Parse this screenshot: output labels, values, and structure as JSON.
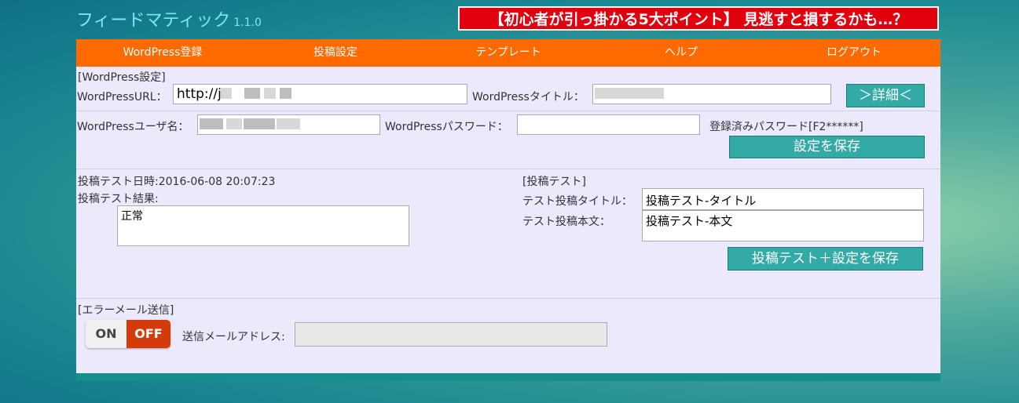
{
  "header": {
    "app_name": "フィードマティック",
    "version": "1.1.0",
    "banner": "【初心者が引っ掛かる5大ポイント】 見逃すと損するかも…？"
  },
  "nav": [
    "WordPress登録",
    "投稿設定",
    "テンプレート",
    "ヘルプ",
    "ログアウト"
  ],
  "wp_settings": {
    "section_title": "[WordPress設定]",
    "url_label": "WordPressURL：",
    "url_value": "http://j",
    "title_label": "WordPressタイトル：",
    "title_value": "",
    "detail_button": "＞詳細＜",
    "user_label": "WordPressユーザ名：",
    "user_value": "",
    "password_label": "WordPressパスワード：",
    "password_value": "",
    "registered_password": "登録済みパスワード[F2******]",
    "save_button": "設定を保存"
  },
  "post_test": {
    "datetime": "投稿テスト日時:2016-06-08 20:07:23",
    "result_label": "投稿テスト結果:",
    "result_value": "正常",
    "section_title": "[投稿テスト]",
    "title_label": "テスト投稿タイトル：",
    "title_value": "投稿テスト-タイトル",
    "body_label": "テスト投稿本文：",
    "body_value": "投稿テスト-本文",
    "save_button": "投稿テスト＋設定を保存"
  },
  "error_mail": {
    "section_title": "[エラーメール送信]",
    "toggle_on": "ON",
    "toggle_off": "OFF",
    "toggle_state": "OFF",
    "address_label": "送信メールアドレス:",
    "address_value": ""
  }
}
